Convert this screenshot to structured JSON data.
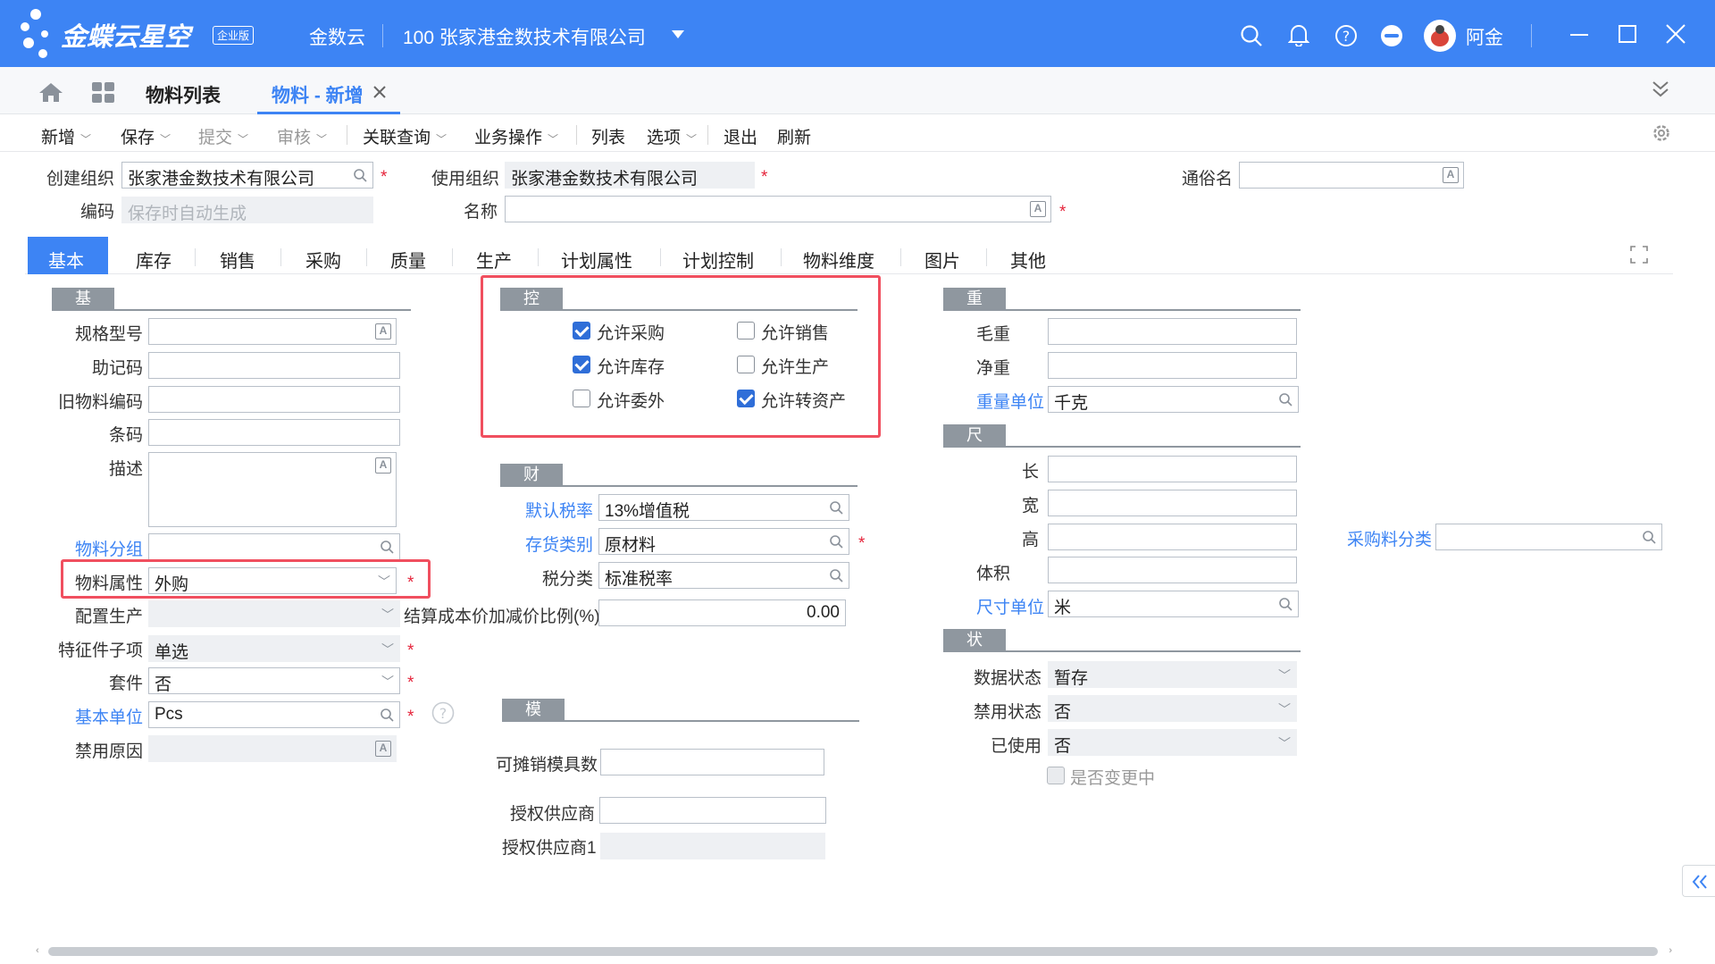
{
  "titlebar": {
    "logo_text": "金蝶云星空",
    "logo_badge": "企业版",
    "product": "金数云",
    "org": "100  张家港金数技术有限公司",
    "user": "阿金"
  },
  "tabs": {
    "list_tab": "物料列表",
    "active_tab": "物料 - 新增"
  },
  "toolbar": {
    "new": "新增",
    "save": "保存",
    "submit": "提交",
    "audit": "审核",
    "related": "关联查询",
    "business": "业务操作",
    "list": "列表",
    "options": "选项",
    "exit": "退出",
    "refresh": "刷新"
  },
  "header": {
    "create_org_label": "创建组织",
    "create_org_value": "张家港金数技术有限公司",
    "use_org_label": "使用组织",
    "use_org_value": "张家港金数技术有限公司",
    "common_name_label": "通俗名",
    "code_label": "编码",
    "code_placeholder": "保存时自动生成",
    "name_label": "名称"
  },
  "subtabs": [
    "基本",
    "库存",
    "销售",
    "采购",
    "质量",
    "生产",
    "计划属性",
    "计划控制",
    "物料维度",
    "图片",
    "其他"
  ],
  "basic": {
    "section": "基本信息",
    "spec_label": "规格型号",
    "mnemonic_label": "助记码",
    "old_code_label": "旧物料编码",
    "barcode_label": "条码",
    "desc_label": "描述",
    "group_label": "物料分组",
    "attr_label": "物料属性",
    "attr_value": "外购",
    "config_label": "配置生产",
    "feature_label": "特征件子项",
    "feature_value": "单选",
    "kit_label": "套件",
    "kit_value": "否",
    "unit_label": "基本单位",
    "unit_value": "Pcs",
    "disable_reason_label": "禁用原因"
  },
  "control": {
    "section": "控制",
    "allow_purchase": "允许采购",
    "allow_sale": "允许销售",
    "allow_stock": "允许库存",
    "allow_produce": "允许生产",
    "allow_outsource": "允许委外",
    "allow_asset": "允许转资产"
  },
  "finance": {
    "section": "财务信息",
    "tax_rate_label": "默认税率",
    "tax_rate_value": "13%增值税",
    "stock_type_label": "存货类别",
    "stock_type_value": "原材料",
    "tax_class_label": "税分类",
    "tax_class_value": "标准税率",
    "cost_ratio_label": "结算成本价加减价比例(%)",
    "cost_ratio_value": "0.00"
  },
  "mold": {
    "section": "模具信息",
    "amortize_label": "可摊销模具数",
    "supplier_label": "授权供应商",
    "supplier1_label": "授权供应商1"
  },
  "weight": {
    "section": "重量信息",
    "gross_label": "毛重",
    "net_label": "净重",
    "unit_label": "重量单位",
    "unit_value": "千克"
  },
  "size": {
    "section": "尺寸信息",
    "length_label": "长",
    "width_label": "宽",
    "height_label": "高",
    "volume_label": "体积",
    "unit_label": "尺寸单位",
    "unit_value": "米"
  },
  "purchase_cat_label": "采购料分类",
  "status": {
    "section": "状态",
    "data_label": "数据状态",
    "data_value": "暂存",
    "disabled_label": "禁用状态",
    "disabled_value": "否",
    "used_label": "已使用",
    "used_value": "否",
    "changing_label": "是否变更中"
  },
  "colors": {
    "primary": "#3d84f4",
    "highlight": "#f04f5f",
    "required": "#e5243b"
  }
}
